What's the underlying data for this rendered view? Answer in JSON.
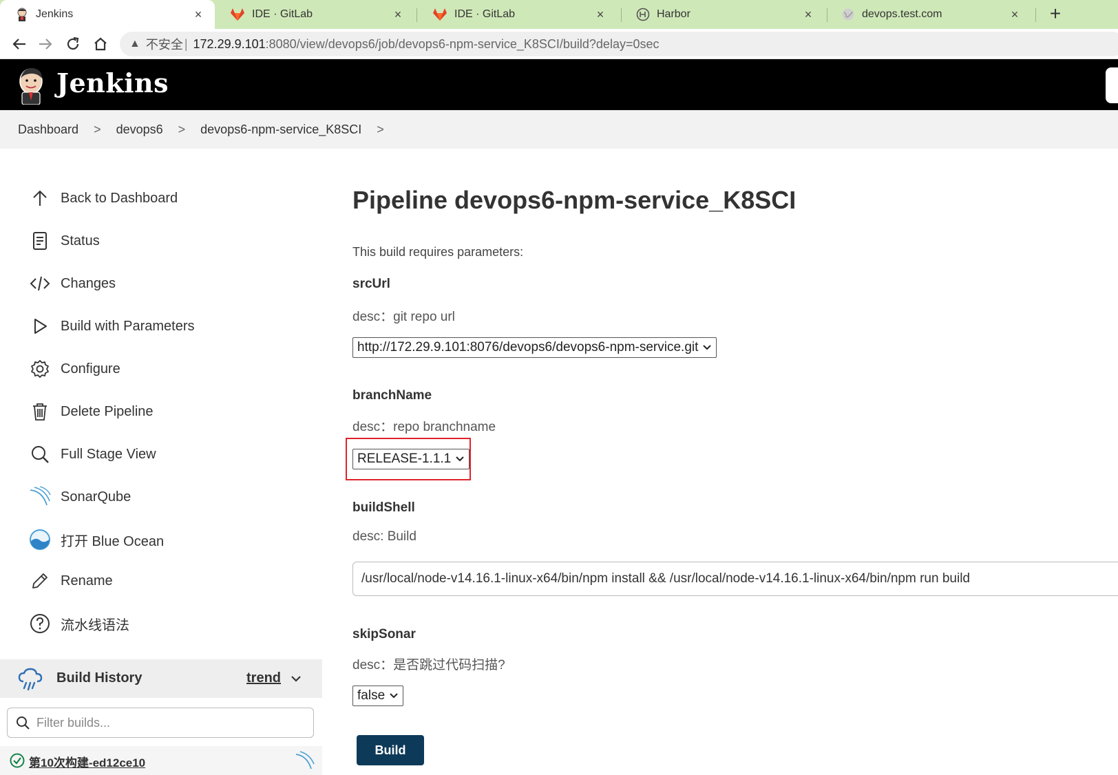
{
  "browser": {
    "tabs": [
      {
        "title": "Jenkins",
        "icon": "jenkins-favicon",
        "active": true
      },
      {
        "title": "IDE · GitLab",
        "icon": "gitlab-icon",
        "active": false
      },
      {
        "title": "IDE · GitLab",
        "icon": "gitlab-icon",
        "active": false
      },
      {
        "title": "Harbor",
        "icon": "harbor-icon",
        "active": false
      },
      {
        "title": "devops.test.com",
        "icon": "globe-icon",
        "active": false
      }
    ],
    "close_glyph": "×",
    "new_tab_glyph": "+",
    "address": {
      "security_label": "不安全",
      "separator": "|",
      "host": "172.29.9.101",
      "path": ":8080/view/devops6/job/devops6-npm-service_K8SCI/build?delay=0sec"
    },
    "colors": {
      "tabbar": "#cfe8b8"
    }
  },
  "header": {
    "title": "Jenkins",
    "colors": {
      "background": "#000000",
      "text": "#ffffff"
    }
  },
  "breadcrumb": {
    "items": [
      "Dashboard",
      "devops6",
      "devops6-npm-service_K8SCI"
    ],
    "separator": ">"
  },
  "sidebar": {
    "items": [
      {
        "label": "Back to Dashboard",
        "icon": "arrow-up-icon"
      },
      {
        "label": "Status",
        "icon": "document-icon"
      },
      {
        "label": "Changes",
        "icon": "code-icon"
      },
      {
        "label": "Build with Parameters",
        "icon": "play-icon"
      },
      {
        "label": "Configure",
        "icon": "gear-icon"
      },
      {
        "label": "Delete Pipeline",
        "icon": "trash-icon"
      },
      {
        "label": "Full Stage View",
        "icon": "search-icon"
      },
      {
        "label": "SonarQube",
        "icon": "sonarqube-icon"
      },
      {
        "label": "打开 Blue Ocean",
        "icon": "blue-ocean-icon"
      },
      {
        "label": "Rename",
        "icon": "pencil-icon"
      },
      {
        "label": "流水线语法",
        "icon": "help-icon"
      }
    ],
    "build_history": {
      "title": "Build History",
      "trend_label": "trend",
      "filter_placeholder": "Filter builds...",
      "builds": [
        {
          "label": "第10次构建-ed12ce10",
          "status": "success"
        }
      ]
    }
  },
  "main": {
    "title": "Pipeline devops6-npm-service_K8SCI",
    "requires_text": "This build requires parameters:",
    "params": [
      {
        "name": "srcUrl",
        "desc": "desc：git repo url",
        "type": "select",
        "value": "http://172.29.9.101:8076/devops6/devops6-npm-service.git"
      },
      {
        "name": "branchName",
        "desc": "desc：repo branchname",
        "type": "select",
        "value": "RELEASE-1.1.1",
        "highlighted": true
      },
      {
        "name": "buildShell",
        "desc": "desc: Build",
        "type": "text",
        "value": "/usr/local/node-v14.16.1-linux-x64/bin/npm install && /usr/local/node-v14.16.1-linux-x64/bin/npm run build"
      },
      {
        "name": "skipSonar",
        "desc": "desc：是否跳过代码扫描?",
        "type": "select",
        "value": "false"
      }
    ],
    "build_button": "Build",
    "colors": {
      "build_button": "#0e3a5a",
      "highlight": "#e0232a",
      "success": "#138347"
    }
  }
}
